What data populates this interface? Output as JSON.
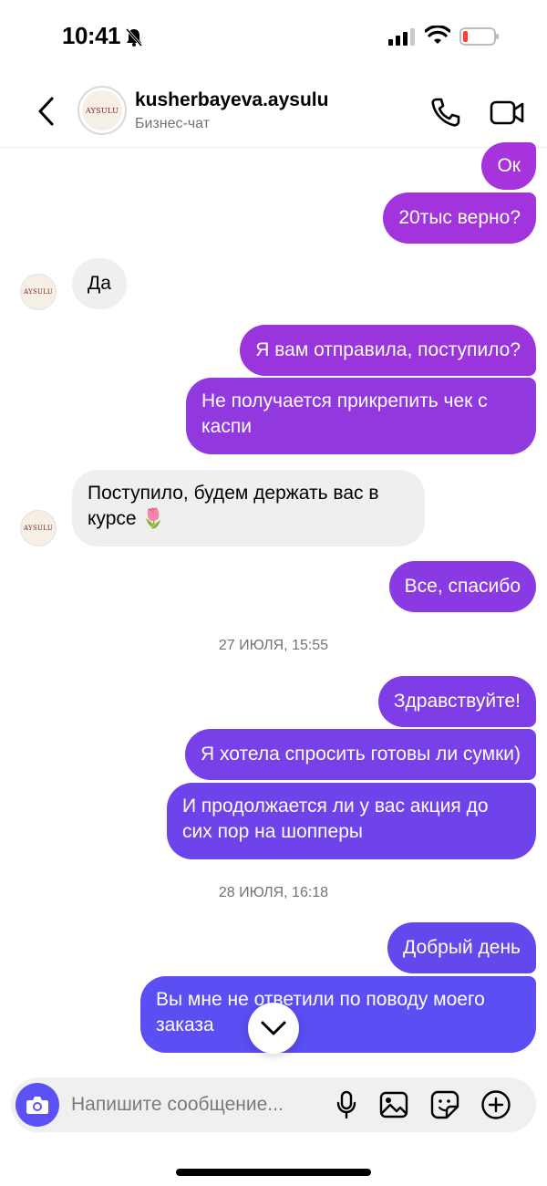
{
  "status_bar": {
    "time": "10:41"
  },
  "header": {
    "name": "kusherbayeva.aysulu",
    "subtitle": "Бизнес-чат",
    "avatar_logo_text": "AYSULU"
  },
  "messages": [
    {
      "direction": "out",
      "text": "Ок"
    },
    {
      "direction": "out",
      "text": "20тыс верно?"
    },
    {
      "direction": "in",
      "text": "Да"
    },
    {
      "direction": "out",
      "text": "Я вам отправила, поступило?"
    },
    {
      "direction": "out",
      "text": "Не получается прикрепить чек с\nкаспи"
    },
    {
      "direction": "in",
      "text": "Поступило, будем держать вас в\nкурсе 🌷"
    },
    {
      "direction": "out",
      "text": "Все, спасибо"
    },
    {
      "direction": "separator",
      "text": "27 ИЮЛЯ, 15:55"
    },
    {
      "direction": "out",
      "text": "Здравствуйте!"
    },
    {
      "direction": "out",
      "text": "Я хотела спросить готовы ли сумки)"
    },
    {
      "direction": "out",
      "text": "И продолжается ли у вас акция до\nсих пор на шопперы"
    },
    {
      "direction": "separator",
      "text": "28 ИЮЛЯ, 16:18"
    },
    {
      "direction": "out",
      "text": "Добрый день"
    },
    {
      "direction": "out",
      "text": "Вы мне не ответили по поводу моего\nзаказа"
    }
  ],
  "composer": {
    "placeholder": "Напишите сообщение..."
  },
  "icons": {
    "back": "chevron-left-icon",
    "call": "phone-icon",
    "video": "video-camera-icon",
    "camera": "camera-icon",
    "mic": "microphone-icon",
    "gallery": "image-icon",
    "sticker": "sticker-icon",
    "plus": "plus-icon",
    "scroll_down": "chevron-down-icon"
  },
  "colors": {
    "out_bubble_top": "#a633dc",
    "out_bubble_bottom": "#5b4ef3",
    "in_bubble": "#efefef",
    "accent": "#5b51f5"
  }
}
